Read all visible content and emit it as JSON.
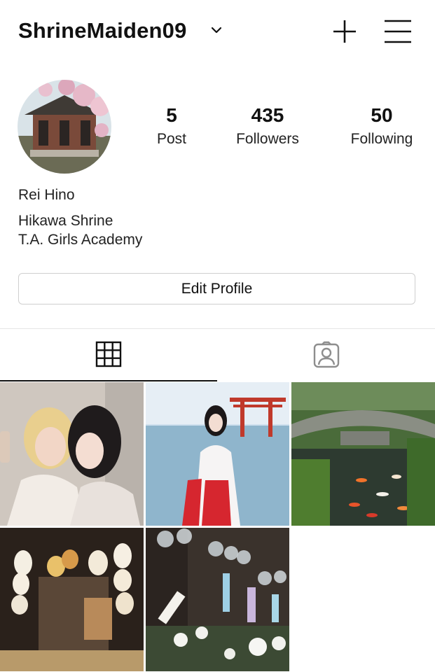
{
  "header": {
    "username": "ShrineMaiden09",
    "icons": [
      "chevron-down-icon",
      "plus-icon",
      "hamburger-menu-icon"
    ]
  },
  "profile": {
    "stats": [
      {
        "value": "5",
        "label": "Post"
      },
      {
        "value": "435",
        "label": "Followers"
      },
      {
        "value": "50",
        "label": "Following"
      }
    ],
    "name": "Rei Hino",
    "bio_line1": "Hikawa Shrine",
    "bio_line2": "T.A. Girls Academy",
    "edit_button": "Edit Profile"
  },
  "tabs": [
    {
      "icon": "grid-icon",
      "active": true
    },
    {
      "icon": "tagged-user-icon",
      "active": false
    }
  ],
  "posts": [
    {
      "name": "two-girls-selfie-photo"
    },
    {
      "name": "shrine-maiden-by-sea-photo"
    },
    {
      "name": "koi-pond-bridge-photo"
    },
    {
      "name": "lantern-room-photo"
    },
    {
      "name": "wind-chimes-photo"
    }
  ],
  "colors": {
    "text": "#111111",
    "border": "#cfcfcf",
    "active_tab": "#111111"
  }
}
